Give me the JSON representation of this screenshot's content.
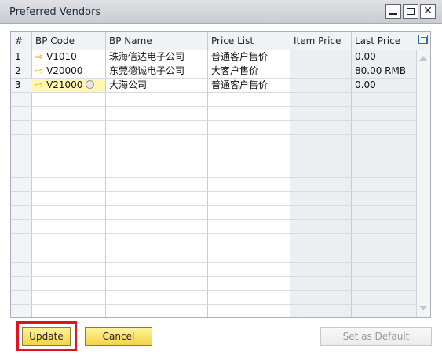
{
  "window": {
    "title": "Preferred Vendors",
    "buttons": {
      "minimize": "minimize-icon",
      "maximize": "maximize-icon",
      "close": "✕"
    }
  },
  "table": {
    "headers": [
      "#",
      "BP Code",
      "BP Name",
      "Price List",
      "Item Price",
      "Last Price"
    ],
    "rows": [
      {
        "num": "1",
        "code": "V1010",
        "name": "珠海信达电子公司",
        "price_list": "普通客户售价",
        "item_price": "",
        "last_price": "0.00"
      },
      {
        "num": "2",
        "code": "V20000",
        "name": "东莞德诚电子公司",
        "price_list": "大客户售价",
        "item_price": "",
        "last_price": "80.00 RMB"
      },
      {
        "num": "3",
        "code": "V21000",
        "name": "大海公司",
        "price_list": "普通客户售价",
        "item_price": "",
        "last_price": "0.00"
      }
    ]
  },
  "buttons": {
    "update": "Update",
    "cancel": "Cancel",
    "set_default": "Set as Default"
  },
  "colors": {
    "button_yellow": "#f3d34a",
    "selected_row": "#fff6b3",
    "highlight_red": "#e0141a",
    "link_arrow": "#e6b100"
  }
}
